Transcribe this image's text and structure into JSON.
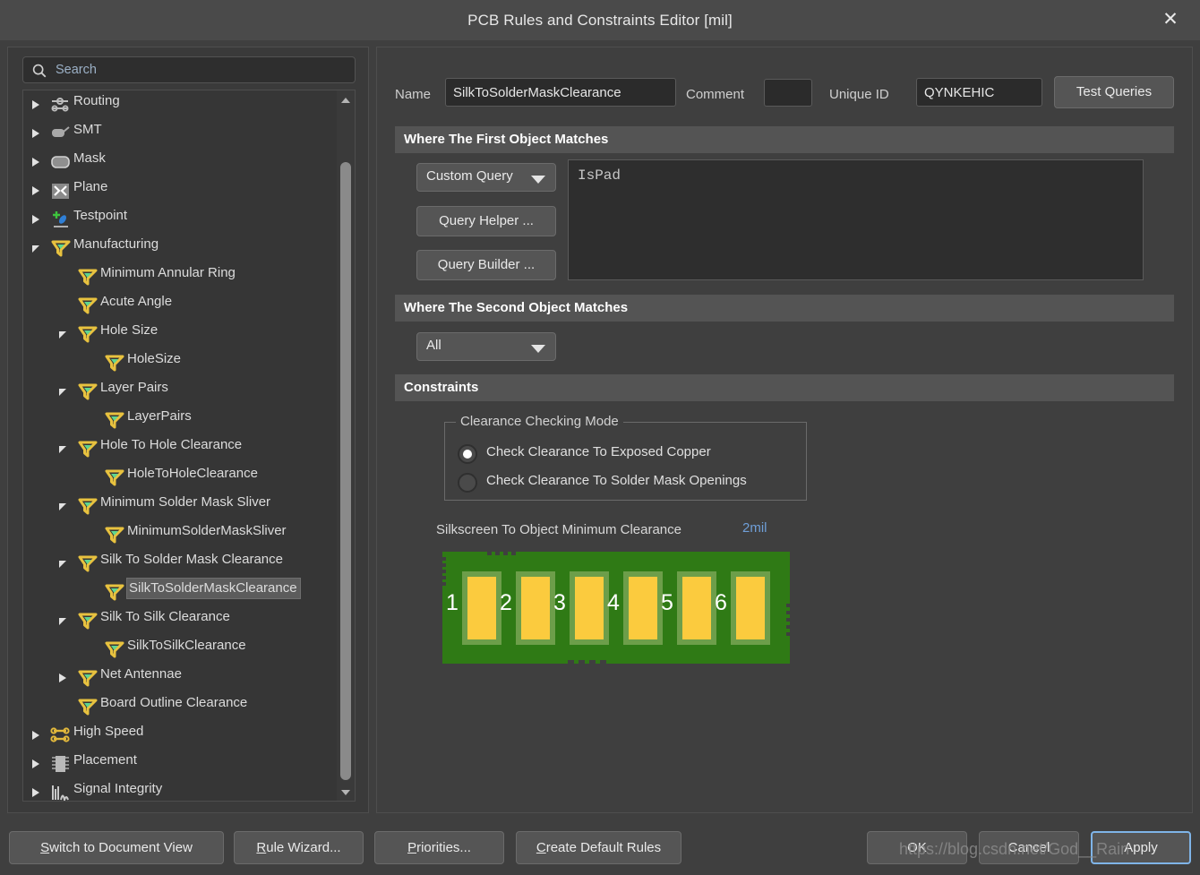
{
  "window": {
    "title": "PCB Rules and Constraints Editor [mil]",
    "close_icon": "close-icon"
  },
  "sidebar": {
    "search": {
      "placeholder": "Search",
      "value": "",
      "icon": "search-icon"
    },
    "tree": [
      {
        "label": "Routing",
        "indent": 0,
        "icon": "routing-icon",
        "toggle": "closed"
      },
      {
        "label": "SMT",
        "indent": 0,
        "icon": "smt-icon",
        "toggle": "closed"
      },
      {
        "label": "Mask",
        "indent": 0,
        "icon": "mask-icon",
        "toggle": "closed"
      },
      {
        "label": "Plane",
        "indent": 0,
        "icon": "plane-icon",
        "toggle": "closed"
      },
      {
        "label": "Testpoint",
        "indent": 0,
        "icon": "testpoint-icon",
        "toggle": "closed"
      },
      {
        "label": "Manufacturing",
        "indent": 0,
        "icon": "rule-flag-icon",
        "toggle": "open"
      },
      {
        "label": "Minimum Annular Ring",
        "indent": 1,
        "icon": "rule-flag-icon",
        "toggle": "none"
      },
      {
        "label": "Acute Angle",
        "indent": 1,
        "icon": "rule-flag-icon",
        "toggle": "none"
      },
      {
        "label": "Hole Size",
        "indent": 1,
        "icon": "rule-flag-icon",
        "toggle": "open"
      },
      {
        "label": "HoleSize",
        "indent": 2,
        "icon": "rule-flag-icon",
        "toggle": "none"
      },
      {
        "label": "Layer Pairs",
        "indent": 1,
        "icon": "rule-flag-icon",
        "toggle": "open"
      },
      {
        "label": "LayerPairs",
        "indent": 2,
        "icon": "rule-flag-icon",
        "toggle": "none"
      },
      {
        "label": "Hole To Hole Clearance",
        "indent": 1,
        "icon": "rule-flag-icon",
        "toggle": "open"
      },
      {
        "label": "HoleToHoleClearance",
        "indent": 2,
        "icon": "rule-flag-icon",
        "toggle": "none"
      },
      {
        "label": "Minimum Solder Mask Sliver",
        "indent": 1,
        "icon": "rule-flag-icon",
        "toggle": "open"
      },
      {
        "label": "MinimumSolderMaskSliver",
        "indent": 2,
        "icon": "rule-flag-icon",
        "toggle": "none"
      },
      {
        "label": "Silk To Solder Mask Clearance",
        "indent": 1,
        "icon": "rule-flag-icon",
        "toggle": "open"
      },
      {
        "label": "SilkToSolderMaskClearance",
        "indent": 2,
        "icon": "rule-flag-icon",
        "toggle": "none",
        "selected": true
      },
      {
        "label": "Silk To Silk Clearance",
        "indent": 1,
        "icon": "rule-flag-icon",
        "toggle": "open"
      },
      {
        "label": "SilkToSilkClearance",
        "indent": 2,
        "icon": "rule-flag-icon",
        "toggle": "none"
      },
      {
        "label": "Net Antennae",
        "indent": 1,
        "icon": "rule-flag-icon",
        "toggle": "closed"
      },
      {
        "label": "Board Outline Clearance",
        "indent": 1,
        "icon": "rule-flag-icon",
        "toggle": "none"
      },
      {
        "label": "High Speed",
        "indent": 0,
        "icon": "high-speed-icon",
        "toggle": "closed"
      },
      {
        "label": "Placement",
        "indent": 0,
        "icon": "placement-icon",
        "toggle": "closed"
      },
      {
        "label": "Signal Integrity",
        "indent": 0,
        "icon": "signal-integrity-icon",
        "toggle": "closed"
      }
    ]
  },
  "form": {
    "name_label": "Name",
    "name_value": "SilkToSolderMaskClearance",
    "comment_label": "Comment",
    "comment_value": "",
    "unique_id_label": "Unique ID",
    "unique_id_value": "QYNKEHIC",
    "test_queries_label": "Test Queries"
  },
  "first_object": {
    "header": "Where The First Object Matches",
    "scope_selected": "Custom Query",
    "query_helper_label": "Query Helper ...",
    "query_builder_label": "Query Builder ...",
    "query_text": "IsPad"
  },
  "second_object": {
    "header": "Where The Second Object Matches",
    "scope_selected": "All"
  },
  "constraints": {
    "header": "Constraints",
    "group_title": "Clearance Checking Mode",
    "options": [
      {
        "label": "Check Clearance To Exposed Copper",
        "checked": true
      },
      {
        "label": "Check Clearance To Solder Mask Openings",
        "checked": false
      }
    ],
    "clearance_label": "Silkscreen To Object Minimum Clearance",
    "clearance_value": "2mil",
    "clearance_value_color": "#6f9fd8",
    "pcb_preview": {
      "board_color": "#2f7a15",
      "pad_color": "#fbcb3e",
      "mask_color": "#6d9e4a",
      "pad_numbers": [
        "1",
        "2",
        "3",
        "4",
        "5",
        "6"
      ]
    }
  },
  "footer": {
    "switch_document_view": "Switch to Document View",
    "switch_document_view_accel": "S",
    "rule_wizard": "Rule Wizard...",
    "rule_wizard_accel": "R",
    "priorities": "Priorities...",
    "priorities_accel": "P",
    "create_default_rules": "Create Default Rules",
    "create_default_rules_accel": "C",
    "ok": "OK",
    "cancel": "Cancel",
    "apply": "Apply"
  },
  "watermark": "https://blog.csdn.net/God__Rain"
}
